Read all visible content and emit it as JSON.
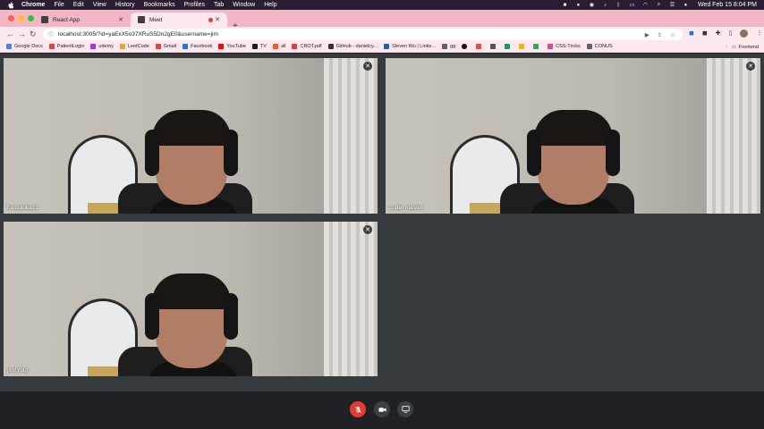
{
  "menubar": {
    "app": "Chrome",
    "menus": [
      "File",
      "Edit",
      "View",
      "History",
      "Bookmarks",
      "Profiles",
      "Tab",
      "Window",
      "Help"
    ],
    "clock": "Wed Feb 15  8:04 PM"
  },
  "tabs": [
    {
      "title": "React App"
    },
    {
      "title": "Meet"
    }
  ],
  "address": {
    "url": "localhost:3005/?id=yaExX5o37XRuS5Dn2gE0&username=jim"
  },
  "bookmarks": [
    {
      "label": "Google Docs",
      "color": "#4285f4"
    },
    {
      "label": "PatientLogin",
      "color": "#ea4335"
    },
    {
      "label": "udemy",
      "color": "#a435f0"
    },
    {
      "label": "LeetCode",
      "color": "#f89f1b"
    },
    {
      "label": "Gmail",
      "color": "#ea4335"
    },
    {
      "label": "Facebook",
      "color": "#1877f2"
    },
    {
      "label": "YouTube",
      "color": "#ff0000"
    },
    {
      "label": "TV",
      "color": "#222222"
    },
    {
      "label": "all",
      "color": "#ff5722"
    },
    {
      "label": "CROT.pdf",
      "color": "#e53935"
    },
    {
      "label": "GitHub - danielcy...",
      "color": "#333333"
    },
    {
      "label": "Steven Wu | Linke...",
      "color": "#0a66c2"
    },
    {
      "label": "gg",
      "color": "#5f6368"
    },
    {
      "label": "CSS-Tricks",
      "color": "#d04e8e"
    },
    {
      "label": "CONUS",
      "color": "#5f6368"
    }
  ],
  "bookmarks_right": "Frontend",
  "participants": [
    {
      "name": "hassankaz1"
    },
    {
      "name": "code_master"
    },
    {
      "name": "jim(You)"
    }
  ],
  "controls": {
    "mic_color": "#e53935",
    "button_color": "#3c4043"
  }
}
